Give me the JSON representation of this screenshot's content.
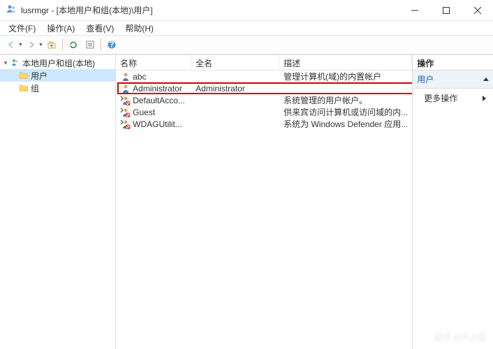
{
  "window": {
    "title": "lusrmgr - [本地用户和组(本地)\\用户]"
  },
  "menu": {
    "file": "文件(F)",
    "action": "操作(A)",
    "view": "查看(V)",
    "help": "帮助(H)"
  },
  "tree": {
    "root": "本地用户和组(本地)",
    "users": "用户",
    "groups": "组"
  },
  "list": {
    "headers": {
      "name": "名称",
      "fullname": "全名",
      "desc": "描述"
    },
    "rows": [
      {
        "name": "abc",
        "fullname": "",
        "desc": "管理计算机(域)的内置帐户",
        "disabled": false
      },
      {
        "name": "Administrator",
        "fullname": "Administrator",
        "desc": "",
        "disabled": false
      },
      {
        "name": "DefaultAcco...",
        "fullname": "",
        "desc": "系统管理的用户帐户。",
        "disabled": true
      },
      {
        "name": "Guest",
        "fullname": "",
        "desc": "供来宾访问计算机或访问域的内...",
        "disabled": true
      },
      {
        "name": "WDAGUtilit...",
        "fullname": "",
        "desc": "系统为 Windows Defender 应用...",
        "disabled": true
      }
    ]
  },
  "actions": {
    "title": "操作",
    "group": "用户",
    "more": "更多操作"
  },
  "watermark": "知乎 @IT小哥"
}
